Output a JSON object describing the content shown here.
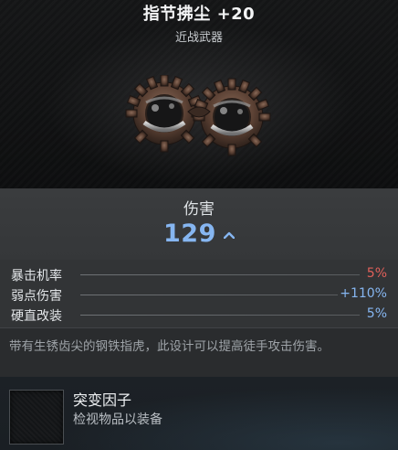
{
  "item": {
    "title": "指节拂尘 +20",
    "type": "近战武器"
  },
  "damage": {
    "label": "伤害",
    "value": "129",
    "trend": "up-arrow-icon",
    "color": "#86b6f1"
  },
  "stats": [
    {
      "name": "暴击机率",
      "value": "5%",
      "color": "#e0605a"
    },
    {
      "name": "弱点伤害",
      "value": "+110%",
      "color": "#86b6f1"
    },
    {
      "name": "硬直改装",
      "value": "5%",
      "color": "#86b6f1"
    }
  ],
  "description": "带有生锈齿尖的钢铁指虎，此设计可以提高徒手攻击伤害。",
  "mutation": {
    "title": "突变因子",
    "hint": "检视物品以装备"
  },
  "icons": {
    "weapon": "brass-knuckles-icon",
    "slot": "mutation-slot-icon"
  }
}
